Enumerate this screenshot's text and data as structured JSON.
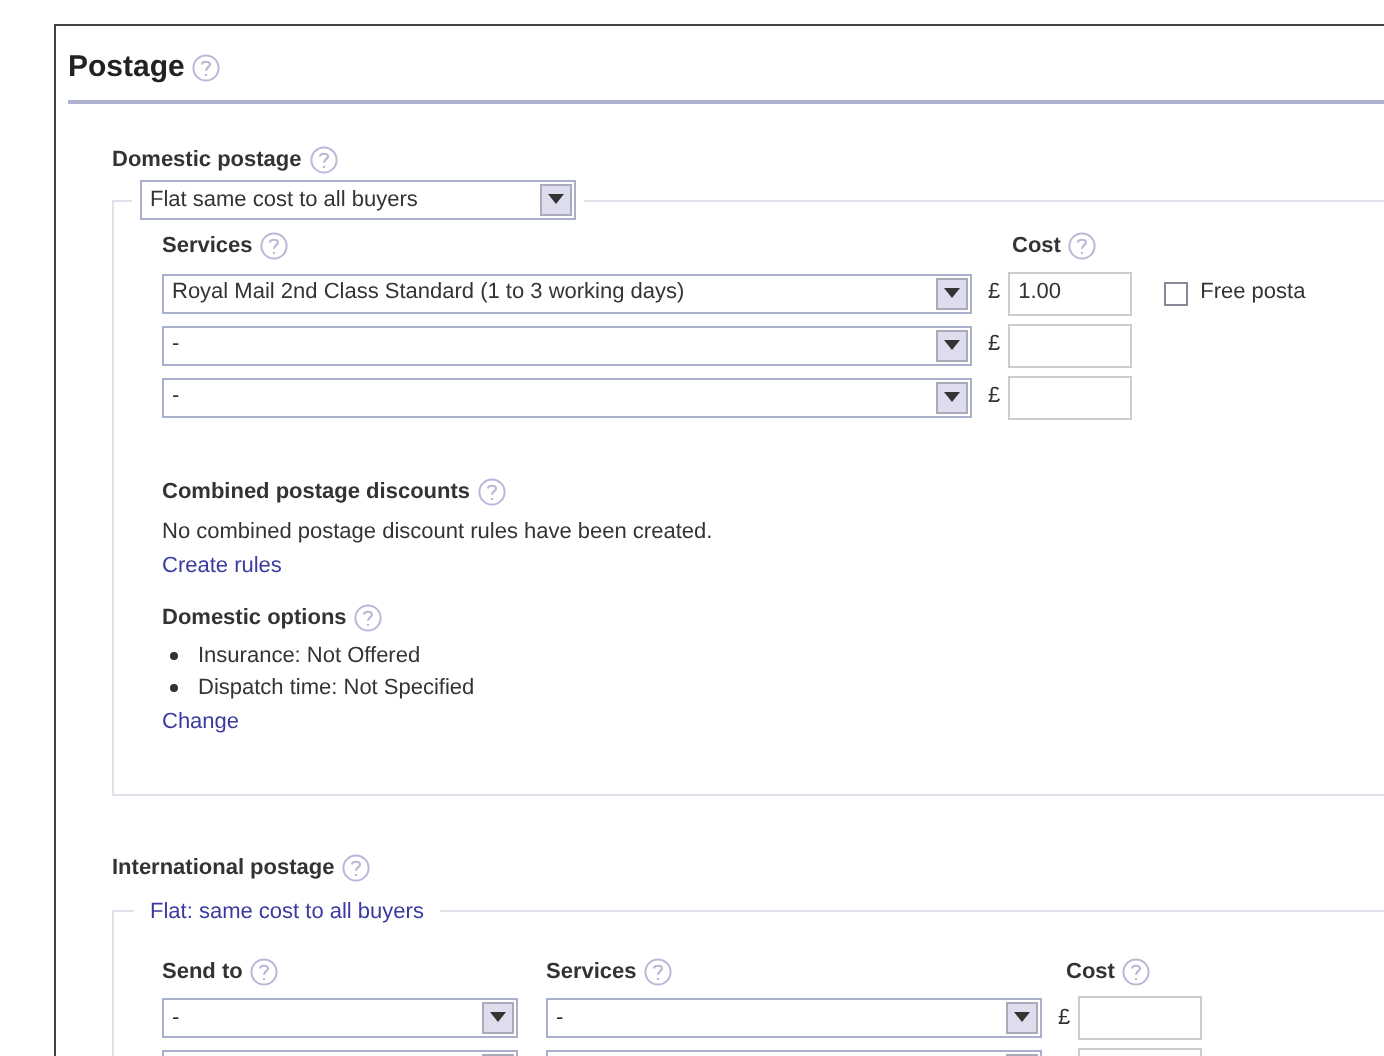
{
  "section": {
    "title": "Postage"
  },
  "domestic": {
    "label": "Domestic postage",
    "type_select": "Flat same cost to all buyers",
    "services_label": "Services",
    "cost_label": "Cost",
    "rows": [
      {
        "service": "Royal Mail 2nd Class Standard  (1 to 3 working days)",
        "currency": "£",
        "cost": "1.00"
      },
      {
        "service": "-",
        "currency": "£"
      },
      {
        "service": "-",
        "currency": "£"
      }
    ],
    "free_postage": {
      "label": "Free posta",
      "checked": false
    },
    "combined": {
      "title": "Combined postage discounts",
      "text": "No combined postage discount rules have been created.",
      "link": "Create rules"
    },
    "options": {
      "title": "Domestic options",
      "items": [
        "Insurance: Not Offered",
        "Dispatch time: Not Specified"
      ],
      "link": "Change"
    }
  },
  "international": {
    "label": "International postage",
    "legend": "Flat: same cost to all buyers",
    "send_to_label": "Send to",
    "services_label": "Services",
    "cost_label": "Cost",
    "rows": [
      {
        "send_to": "-",
        "service": "-",
        "currency": "£"
      },
      {}
    ]
  }
}
